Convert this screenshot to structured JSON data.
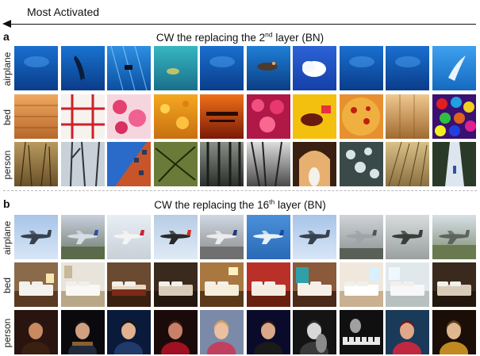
{
  "header": {
    "label": "Most Activated"
  },
  "panels": [
    {
      "letter": "a",
      "title_prefix": "CW the replacing the 2",
      "title_sup": "nd",
      "title_suffix": " layer (BN)",
      "rows": [
        {
          "label": "airplane",
          "tiles": [
            "water",
            "water-dolphin",
            "water-diver",
            "water-fish",
            "water",
            "water-whale",
            "sky-cloud",
            "water",
            "water",
            "water-light"
          ]
        },
        {
          "label": "bed",
          "tiles": [
            "sauna",
            "window-grid",
            "flowers",
            "orange-texture",
            "sunset-text",
            "roses",
            "bull",
            "pizza",
            "wood-panels",
            "candy"
          ]
        },
        {
          "label": "person",
          "tiles": [
            "grass",
            "bare-trees",
            "brick-building",
            "palm",
            "forest",
            "forest-bw",
            "arch-couple",
            "snow-tree",
            "reeds",
            "waterfall"
          ]
        }
      ]
    },
    {
      "letter": "b",
      "title_prefix": "CW the replacing the 16",
      "title_sup": "th",
      "title_suffix": " layer (BN)",
      "rows": [
        {
          "label": "airplane",
          "tiles": [
            "plane-sky",
            "plane-ground",
            "plane-white",
            "plane-red",
            "plane-runway",
            "plane-blue",
            "plane-sky",
            "plane-grey",
            "plane-old",
            "plane-field"
          ]
        },
        {
          "label": "bed",
          "tiles": [
            "bedroom",
            "bedroom-white",
            "bedroom-brown",
            "bedroom-dark",
            "bedroom-warm",
            "bedroom-red",
            "bedroom-teal",
            "bedroom-bright",
            "bedroom-light",
            "bedroom-dark"
          ]
        },
        {
          "label": "person",
          "tiles": [
            "concert",
            "guitarist",
            "portrait-smile",
            "singer-dark",
            "portrait-blonde",
            "stage-performer",
            "cello-bw",
            "piano-bw",
            "singer-mic",
            "singer-gold"
          ]
        }
      ]
    }
  ]
}
